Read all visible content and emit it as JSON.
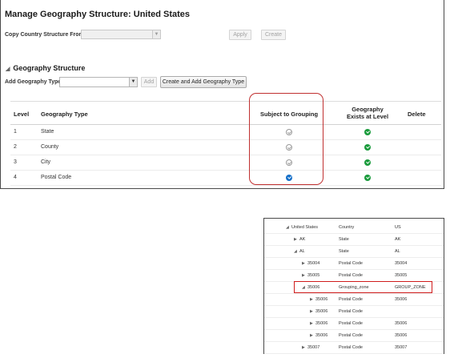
{
  "page": {
    "title": "Manage Geography Structure: United States",
    "copy_label": "Copy Country Structure From",
    "apply_label": "Apply",
    "create_label": "Create"
  },
  "section": {
    "title": "Geography Structure",
    "add_label": "Add Geography Type",
    "add_button": "Add",
    "create_add_button": "Create and Add Geography Type"
  },
  "grid": {
    "columns": [
      "Level",
      "Geography Type",
      "Subject to Grouping",
      "Geography Exists at Level",
      "Delete"
    ],
    "rows": [
      {
        "level": "1",
        "type": "State",
        "grouping": "unchecked",
        "exists": "yes"
      },
      {
        "level": "2",
        "type": "County",
        "grouping": "unchecked",
        "exists": "yes"
      },
      {
        "level": "3",
        "type": "City",
        "grouping": "unchecked",
        "exists": "yes"
      },
      {
        "level": "4",
        "type": "Postal Code",
        "grouping": "checked",
        "exists": "yes"
      }
    ]
  },
  "tree": {
    "rows": [
      {
        "name": "United States",
        "type": "Country",
        "code": "US",
        "toggle": "expanded"
      },
      {
        "name": "AK",
        "type": "State",
        "code": "AK",
        "toggle": "collapsed"
      },
      {
        "name": "AL",
        "type": "State",
        "code": "AL",
        "toggle": "expanded"
      },
      {
        "name": "35004",
        "type": "Postal Code",
        "code": "35004",
        "toggle": "collapsed"
      },
      {
        "name": "35005",
        "type": "Postal Code",
        "code": "35005",
        "toggle": "collapsed"
      },
      {
        "name": "35006",
        "type": "Grouping_zone",
        "code": "GROUP_ZONE",
        "toggle": "expanded"
      },
      {
        "name": "35006",
        "type": "Postal Code",
        "code": "35006",
        "toggle": "collapsed"
      },
      {
        "name": "35006",
        "type": "Postal Code",
        "code": "",
        "toggle": "collapsed"
      },
      {
        "name": "35006",
        "type": "Postal Code",
        "code": "35006",
        "toggle": "collapsed"
      },
      {
        "name": "35006",
        "type": "Postal Code",
        "code": "35006",
        "toggle": "collapsed"
      },
      {
        "name": "35007",
        "type": "Postal Code",
        "code": "35007",
        "toggle": "collapsed"
      }
    ]
  },
  "colors": {
    "highlight": "#c03030",
    "check_green": "#1a9b3c",
    "check_blue": "#1670c9"
  }
}
